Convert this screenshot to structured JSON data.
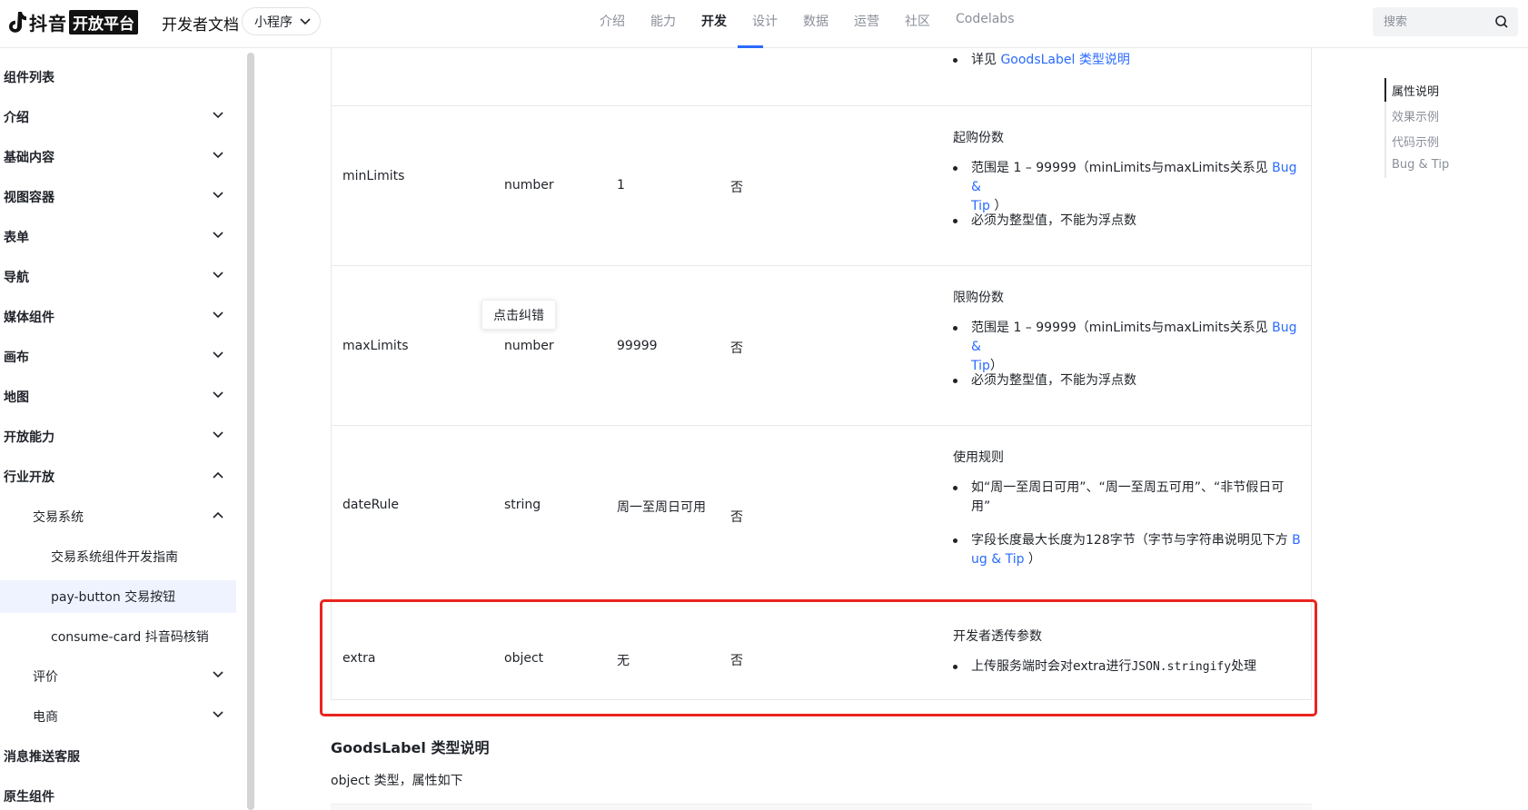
{
  "header": {
    "logo_text": "抖音",
    "logo_badge": "开放平台",
    "doc_title": "开发者文档",
    "product_select": "小程序",
    "nav": [
      "介绍",
      "能力",
      "开发",
      "设计",
      "数据",
      "运营",
      "社区",
      "Codelabs"
    ],
    "nav_active": "开发",
    "search_placeholder": "搜索"
  },
  "sidebar": {
    "items": [
      {
        "label": "组件列表"
      },
      {
        "label": "介绍"
      },
      {
        "label": "基础内容"
      },
      {
        "label": "视图容器"
      },
      {
        "label": "表单"
      },
      {
        "label": "导航"
      },
      {
        "label": "媒体组件"
      },
      {
        "label": "画布"
      },
      {
        "label": "地图"
      },
      {
        "label": "开放能力"
      },
      {
        "label": "行业开放"
      },
      {
        "label": "交易系统"
      },
      {
        "label": "交易系统组件开发指南"
      },
      {
        "label": "pay-button 交易按钮"
      },
      {
        "label": "consume-card 抖音码核销"
      },
      {
        "label": "评价"
      },
      {
        "label": "电商"
      },
      {
        "label": "消息推送客服"
      },
      {
        "label": "原生组件"
      }
    ]
  },
  "table": {
    "top_row_bullet": {
      "prefix": "详见 ",
      "link": "GoodsLabel 类型说明"
    },
    "rows": [
      {
        "name": "minLimits",
        "type": "number",
        "default": "1",
        "required": "否",
        "desc_title": "起购份数",
        "b1_prefix": "范围是 1 – 99999（minLimits与maxLimits关系见 ",
        "b1_link1": "Bug &",
        "b1_link2": "Tip",
        "b1_suffix": " ）",
        "b2": "必须为整型值，不能为浮点数"
      },
      {
        "name": "maxLimits",
        "type": "number",
        "default": "99999",
        "required": "否",
        "desc_title": "限购份数",
        "b1_prefix": "范围是 1 – 99999（minLimits与maxLimits关系见 ",
        "b1_link1": "Bug &",
        "b1_link2": "Tip",
        "b1_suffix": "）",
        "b2": "必须为整型值，不能为浮点数"
      },
      {
        "name": "dateRule",
        "type": "string",
        "default": "周一至周日可用",
        "required": "否",
        "desc_title": "使用规则",
        "b1_line1": "如“周一至周日可用”、“周一至周五可用”、“非节假日可",
        "b1_line2": "用”",
        "b2_prefix": "字段长度最大长度为128字节（字节与字符串说明见下方 ",
        "b2_link1": "B",
        "b2_link2": "ug & Tip",
        "b2_suffix": " ）"
      },
      {
        "name": "extra",
        "type": "object",
        "default": "无",
        "required": "否",
        "desc_title": "开发者透传参数",
        "b1_prefix": "上传服务端时会对extra进行",
        "b1_code": "JSON.stringify",
        "b1_suffix": "处理"
      }
    ]
  },
  "tooltip": "点击纠错",
  "section": {
    "title": "GoodsLabel 类型说明",
    "text": "object 类型，属性如下"
  },
  "toc": [
    "属性说明",
    "效果示例",
    "代码示例",
    "Bug & Tip"
  ],
  "colors": {
    "accent": "#2a6bff",
    "highlight": "#e8251e",
    "selected_bg": "#eef3ff"
  }
}
